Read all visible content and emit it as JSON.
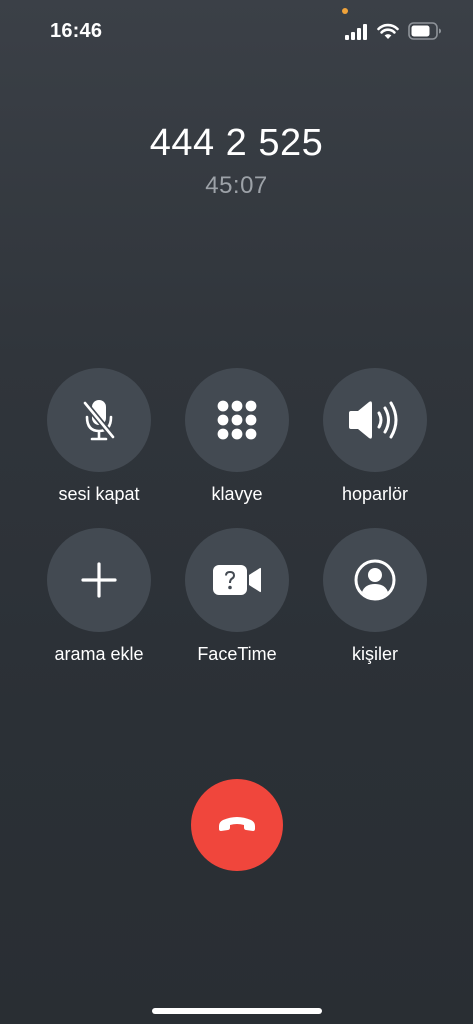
{
  "status_bar": {
    "time": "16:46",
    "privacy_dot_color": "#f0a33a",
    "icons": [
      "signal-icon",
      "wifi-icon",
      "battery-icon"
    ]
  },
  "call": {
    "number": "444 2 525",
    "duration": "45:07"
  },
  "controls": [
    {
      "label": "sesi kapat",
      "icon": "microphone-slash-icon"
    },
    {
      "label": "klavye",
      "icon": "keypad-icon"
    },
    {
      "label": "hoparlör",
      "icon": "speaker-icon"
    },
    {
      "label": "arama ekle",
      "icon": "plus-icon"
    },
    {
      "label": "FaceTime",
      "icon": "facetime-unavailable-icon"
    },
    {
      "label": "kişiler",
      "icon": "contacts-icon"
    }
  ],
  "end_call": {
    "icon": "end-call-icon",
    "color": "#f0463c"
  }
}
